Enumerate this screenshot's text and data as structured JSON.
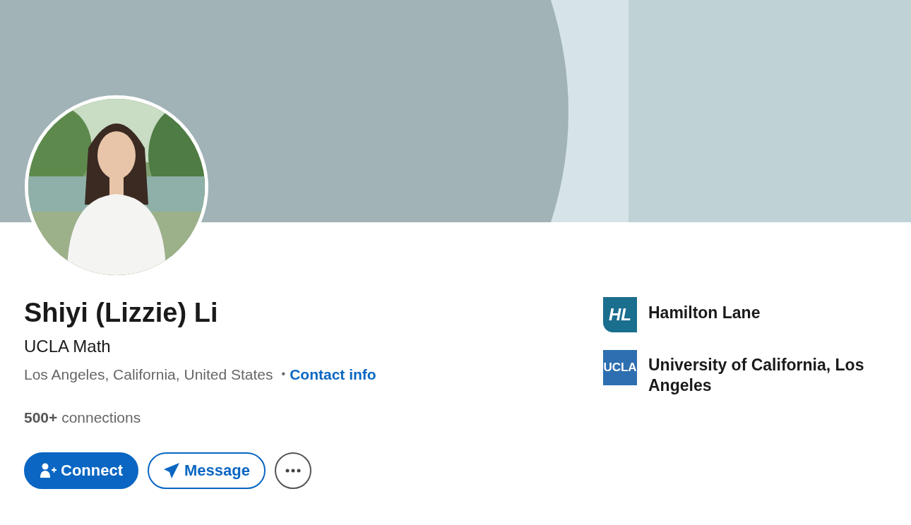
{
  "profile": {
    "name": "Shiyi (Lizzie) Li",
    "headline": "UCLA Math",
    "location": "Los Angeles, California, United States",
    "separator": "•",
    "contact_link": "Contact info",
    "connections_count": "500+",
    "connections_label": "connections"
  },
  "actions": [
    {
      "kind": "primary",
      "label": "Connect"
    },
    {
      "kind": "outline",
      "label": "Message"
    },
    {
      "kind": "more"
    }
  ],
  "organizations": [
    {
      "kind": "company",
      "logo_text": "HL",
      "name": "Hamilton Lane"
    },
    {
      "kind": "school",
      "logo_text": "UCLA",
      "name": "University of California, Los Angeles"
    }
  ]
}
